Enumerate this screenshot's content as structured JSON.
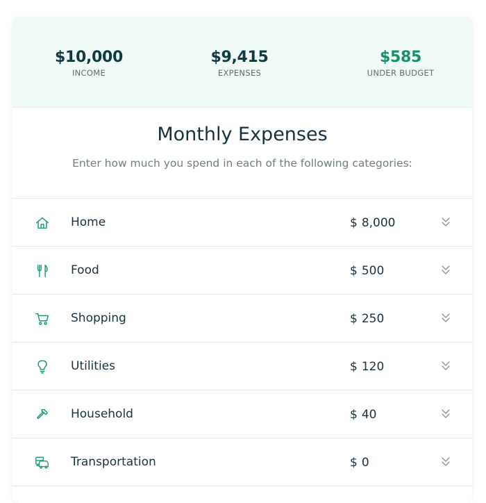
{
  "summary": {
    "income": {
      "value": "$10,000",
      "label": "INCOME"
    },
    "expenses": {
      "value": "$9,415",
      "label": "EXPENSES"
    },
    "budget": {
      "value": "$585",
      "label": "UNDER BUDGET"
    }
  },
  "heading": "Monthly Expenses",
  "subheading": "Enter how much you spend in each of the following categories:",
  "currency_symbol": "$",
  "categories": [
    {
      "name": "Home",
      "amount": "8,000",
      "icon": "home-icon"
    },
    {
      "name": "Food",
      "amount": "500",
      "icon": "utensils-icon"
    },
    {
      "name": "Shopping",
      "amount": "250",
      "icon": "shopping-cart-icon"
    },
    {
      "name": "Utilities",
      "amount": "120",
      "icon": "lightbulb-icon"
    },
    {
      "name": "Household",
      "amount": "40",
      "icon": "hammer-icon"
    },
    {
      "name": "Transportation",
      "amount": "0",
      "icon": "vehicles-icon"
    }
  ],
  "colors": {
    "accent": "#188f6b",
    "header_bg": "#effaf6",
    "dark_text": "#0f3a41",
    "icon": "#1d9a76"
  }
}
